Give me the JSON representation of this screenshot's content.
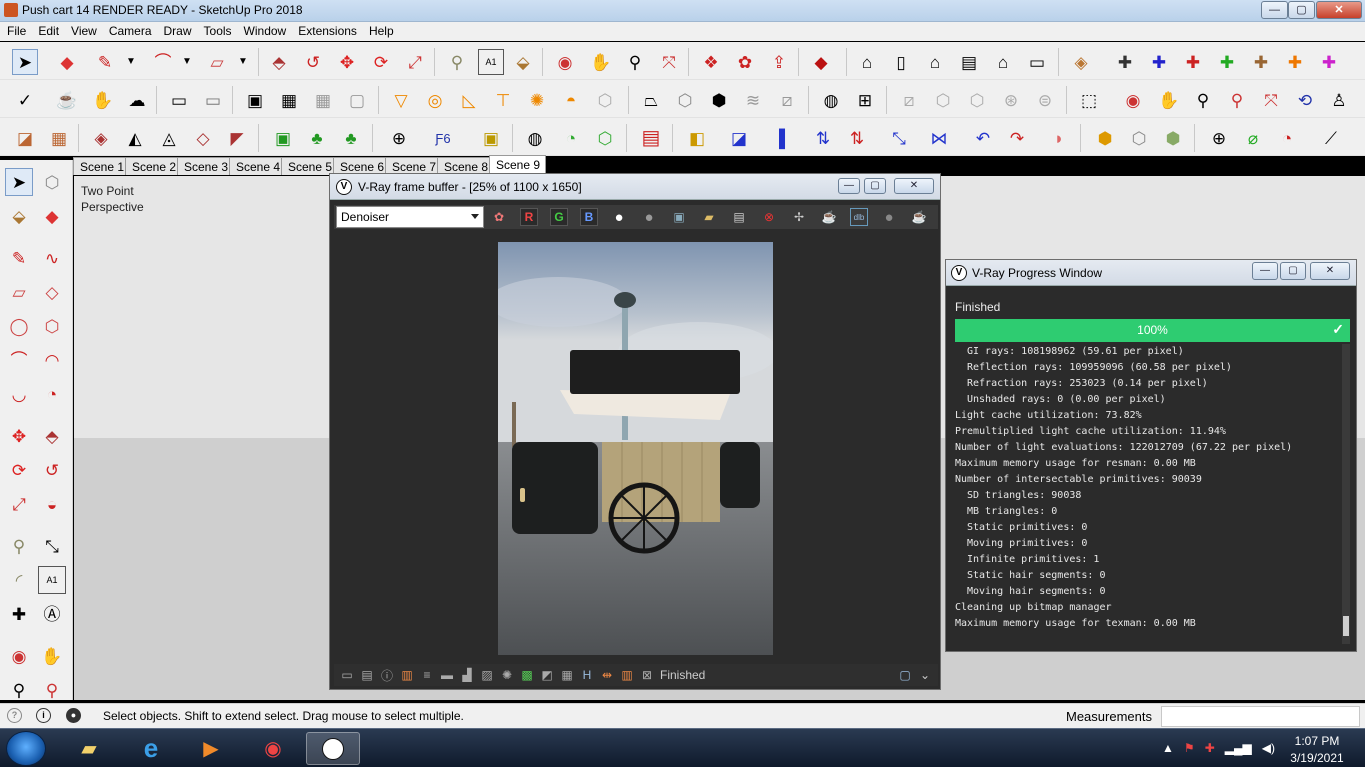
{
  "window": {
    "title": "Push cart 14 RENDER READY - SketchUp Pro 2018",
    "minimize": "—",
    "maximize": "▢",
    "close": "✕"
  },
  "menu": [
    "File",
    "Edit",
    "View",
    "Camera",
    "Draw",
    "Tools",
    "Window",
    "Extensions",
    "Help"
  ],
  "scenes": {
    "tabs": [
      "Scene 1",
      "Scene 2",
      "Scene 3",
      "Scene 4",
      "Scene 5",
      "Scene 6",
      "Scene 7",
      "Scene 8",
      "Scene 9"
    ],
    "active": "Scene 9"
  },
  "viewport": {
    "camera_line1": "Two Point",
    "camera_line2": "Perspective"
  },
  "frame_buffer": {
    "title": "V-Ray frame buffer - [25% of 1100 x 1650]",
    "denoiser_select": "Denoiser",
    "channel_r": "R",
    "channel_g": "G",
    "channel_b": "B",
    "status": "Finished",
    "logo": "V"
  },
  "progress_window": {
    "title": "V-Ray Progress Window",
    "status": "Finished",
    "progress_label": "100%",
    "progress_fraction": 1.0,
    "progress_color": "#2ecc71",
    "log": [
      {
        "text": "GI rays: 108198962 (59.61 per pixel)",
        "indent": true
      },
      {
        "text": "Reflection rays: 109959096 (60.58 per pixel)",
        "indent": true
      },
      {
        "text": "Refraction rays: 253023 (0.14 per pixel)",
        "indent": true
      },
      {
        "text": "Unshaded rays: 0 (0.00 per pixel)",
        "indent": true
      },
      {
        "text": "Light cache utilization: 73.82%",
        "indent": false
      },
      {
        "text": "Premultiplied light cache utilization: 11.94%",
        "indent": false
      },
      {
        "text": "Number of light evaluations: 122012709 (67.22 per pixel)",
        "indent": false
      },
      {
        "text": "Maximum memory usage for resman: 0.00 MB",
        "indent": false
      },
      {
        "text": "Number of intersectable primitives: 90039",
        "indent": false
      },
      {
        "text": "SD triangles: 90038",
        "indent": true
      },
      {
        "text": "MB triangles: 0",
        "indent": true
      },
      {
        "text": "Static primitives: 0",
        "indent": true
      },
      {
        "text": "Moving primitives: 0",
        "indent": true
      },
      {
        "text": "Infinite primitives: 1",
        "indent": true
      },
      {
        "text": "Static hair segments: 0",
        "indent": true
      },
      {
        "text": "Moving hair segments: 0",
        "indent": true
      },
      {
        "text": "Cleaning up bitmap manager",
        "indent": false
      },
      {
        "text": "Maximum memory usage for texman: 0.00 MB",
        "indent": false
      }
    ]
  },
  "status_bar": {
    "hint": "Select objects. Shift to extend select. Drag mouse to select multiple.",
    "measurements_label": "Measurements",
    "measurements_value": ""
  },
  "taskbar": {
    "time": "1:07 PM",
    "date": "3/19/2021"
  }
}
